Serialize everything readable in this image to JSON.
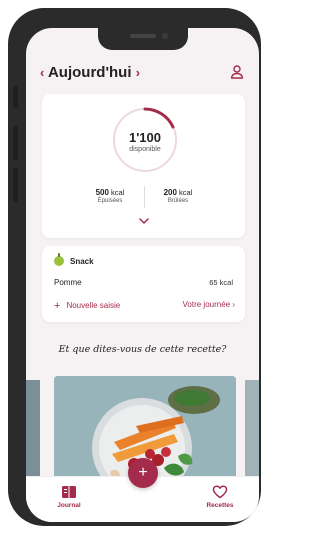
{
  "header": {
    "prev_label": "‹",
    "title": "Aujourd'hui",
    "next_label": "›",
    "profile_icon": "person-icon"
  },
  "summary": {
    "available_value": "1'100",
    "available_label": "disponible",
    "consumed_value": "500",
    "consumed_unit": "kcal",
    "consumed_label": "Épuisées",
    "burned_value": "200",
    "burned_unit": "kcal",
    "burned_label": "Brûlées",
    "expand_icon": "chevron-down-icon"
  },
  "snack": {
    "title": "Snack",
    "icon": "apple-icon",
    "item_name": "Pomme",
    "item_kcal": "65 kcal",
    "add_label": "Nouvelle saisie",
    "day_label": "Votre journée ›"
  },
  "tagline": "Et que dites-vous de cette recette?",
  "bottom_nav": {
    "journal_label": "Journal",
    "recipes_label": "Recettes",
    "add_icon": "plus-icon"
  },
  "colors": {
    "accent": "#a42b4b",
    "background": "#f6f2f3",
    "ring_track": "#ecd9de",
    "card": "#ffffff"
  }
}
